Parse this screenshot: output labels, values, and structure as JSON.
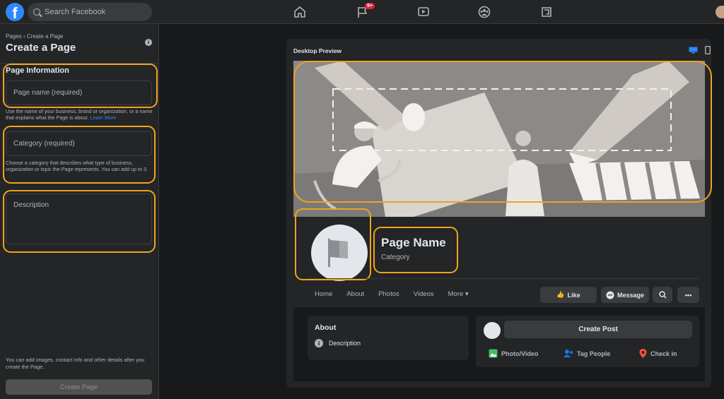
{
  "topbar": {
    "logo": "f",
    "search_placeholder": "Search Facebook",
    "notification_badge": "9+",
    "nav_icons": [
      "home-icon",
      "flag-icon",
      "watch-icon",
      "groups-icon",
      "gaming-icon"
    ]
  },
  "left": {
    "breadcrumb": "Pages › Create a Page",
    "title": "Create a Page",
    "section_label": "Page Information",
    "page_name_placeholder": "Page name (required)",
    "page_name_help": "Use the name of your business, brand or organization, or a name that explains what the Page is about.",
    "learn_more": "Learn More",
    "category_placeholder": "Category (required)",
    "category_help": "Choose a category that describes what type of business, organization or topic the Page represents. You can add up to 3.",
    "description_placeholder": "Description",
    "footer_note": "You can add images, contact info and other details after you create the Page.",
    "create_button": "Create Page"
  },
  "preview": {
    "title": "Desktop Preview",
    "page_name": "Page Name",
    "category": "Category",
    "tabs": [
      "Home",
      "About",
      "Photos",
      "Videos",
      "More ▾"
    ],
    "like_button": "Like",
    "message_button": "Message",
    "about_title": "About",
    "about_description": "Description",
    "create_post_button": "Create Post",
    "actions": [
      "Photo/Video",
      "Tag People",
      "Check in"
    ]
  },
  "colors": {
    "accent": "#2d88ff",
    "highlight": "#f0a31d",
    "background": "#18191a",
    "surface": "#242526"
  }
}
